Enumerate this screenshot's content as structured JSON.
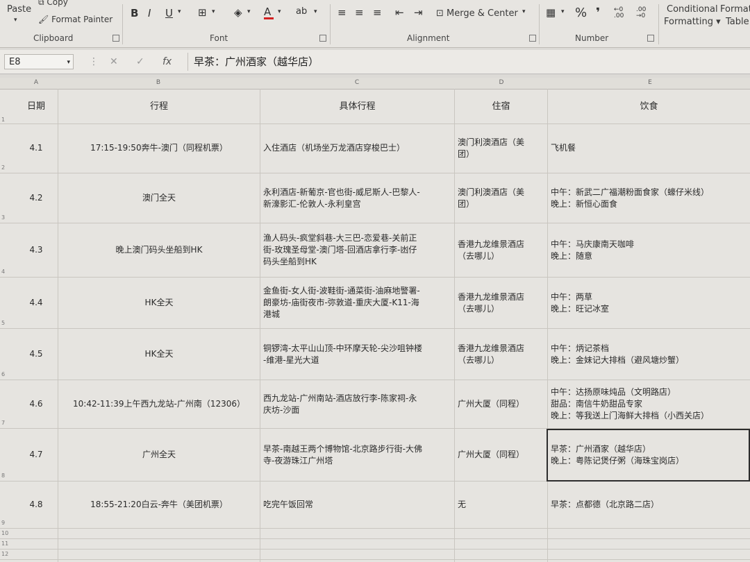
{
  "ribbon": {
    "paste": "Paste",
    "copy": "Copy",
    "format_painter": "Format Painter",
    "clipboard": "Clipboard",
    "font": "Font",
    "alignment": "Alignment",
    "number": "Number",
    "merge_center": "Merge & Center",
    "conditional_1": "Conditional",
    "conditional_2": "Formatting",
    "format_table_1": "Format",
    "format_table_2": "Table",
    "bold": "B",
    "italic": "I",
    "underline": "U",
    "font_color": "A",
    "percent": "%",
    "comma": "❜",
    "inc_decimal": "←0 .00",
    "dec_decimal": ".00 →0"
  },
  "formula_bar": {
    "cell_ref": "E8",
    "content": "早茶：广州酒家（越华店）"
  },
  "columns": [
    "A",
    "B",
    "C",
    "D",
    "E"
  ],
  "headers": {
    "date": "日期",
    "route": "行程",
    "detail": "具体行程",
    "hotel": "住宿",
    "food": "饮食"
  },
  "rows": [
    {
      "num": "2",
      "date": "4.1",
      "route": "17:15-19:50奔牛-澳门（同程机票）",
      "detail": [
        "入住酒店（机场坐万龙酒店穿梭巴士）"
      ],
      "hotel": [
        "澳门利澳酒店（美",
        "团）"
      ],
      "food": [
        "飞机餐"
      ]
    },
    {
      "num": "3",
      "date": "4.2",
      "route": "澳门全天",
      "detail": [
        "永利酒店-新葡京-官也街-威尼斯人-巴黎人-",
        "新濠影汇-伦敦人-永利皇宫"
      ],
      "hotel": [
        "澳门利澳酒店（美",
        "团）"
      ],
      "food": [
        "中午：新武二广福潮粉面食家（蠔仔米线）",
        "晚上：新恒心面食"
      ]
    },
    {
      "num": "4",
      "date": "4.3",
      "route": "晚上澳门码头坐船到HK",
      "detail": [
        "渔人码头-疯堂斜巷-大三巴-恋爱巷-关前正",
        "街-玫瑰圣母堂-澳门塔-回酒店拿行李-凼仔",
        "码头坐船到HK"
      ],
      "hotel": [
        "香港九龙维景酒店",
        "（去哪儿）"
      ],
      "food": [
        "中午：马庆康南天咖啡",
        "晚上：随意"
      ]
    },
    {
      "num": "5",
      "date": "4.4",
      "route": "HK全天",
      "detail": [
        "金鱼街-女人街-波鞋街-通菜街-油麻地警署-",
        "朗豪坊-庙街夜市-弥敦道-重庆大厦-K11-海",
        "港城"
      ],
      "hotel": [
        "香港九龙维景酒店",
        "（去哪儿）"
      ],
      "food": [
        "中午：两草",
        "晚上：旺记冰室"
      ]
    },
    {
      "num": "6",
      "date": "4.5",
      "route": "HK全天",
      "detail": [
        "铜锣湾-太平山山顶-中环摩天轮-尖沙咀钟楼",
        "-维港-星光大道"
      ],
      "hotel": [
        "香港九龙维景酒店",
        "（去哪儿）"
      ],
      "food": [
        "中午：炳记茶档",
        "晚上：金妹记大排档（避风塘炒蟹）"
      ]
    },
    {
      "num": "7",
      "date": "4.6",
      "route": "10:42-11:39上午西九龙站-广州南（12306）",
      "detail": [
        "西九龙站-广州南站-酒店放行李-陈家祠-永",
        "庆坊-沙面"
      ],
      "hotel": [
        "广州大厦（同程）"
      ],
      "food": [
        "中午：达扬原味炖品（文明路店）",
        "甜品：南信牛奶甜品专家",
        "晚上：等我送上门海鲜大排档（小西关店）"
      ]
    },
    {
      "num": "8",
      "date": "4.7",
      "route": "广州全天",
      "detail": [
        "早茶-南越王两个博物馆-北京路步行街-大佛",
        "寺-夜游珠江广州塔"
      ],
      "hotel": [
        "广州大厦（同程）"
      ],
      "food": [
        "早茶：广州酒家（越华店）",
        "晚上：粤陈记煲仔粥（海珠宝岗店）"
      ]
    },
    {
      "num": "9",
      "date": "4.8",
      "route": "18:55-21:20白云-奔牛（美团机票）",
      "detail": [
        "吃完午饭回常"
      ],
      "hotel": [
        "无"
      ],
      "food": [
        "早茶：点都德（北京路二店）"
      ]
    }
  ],
  "trailing_rows": [
    "10",
    "11",
    "12"
  ]
}
